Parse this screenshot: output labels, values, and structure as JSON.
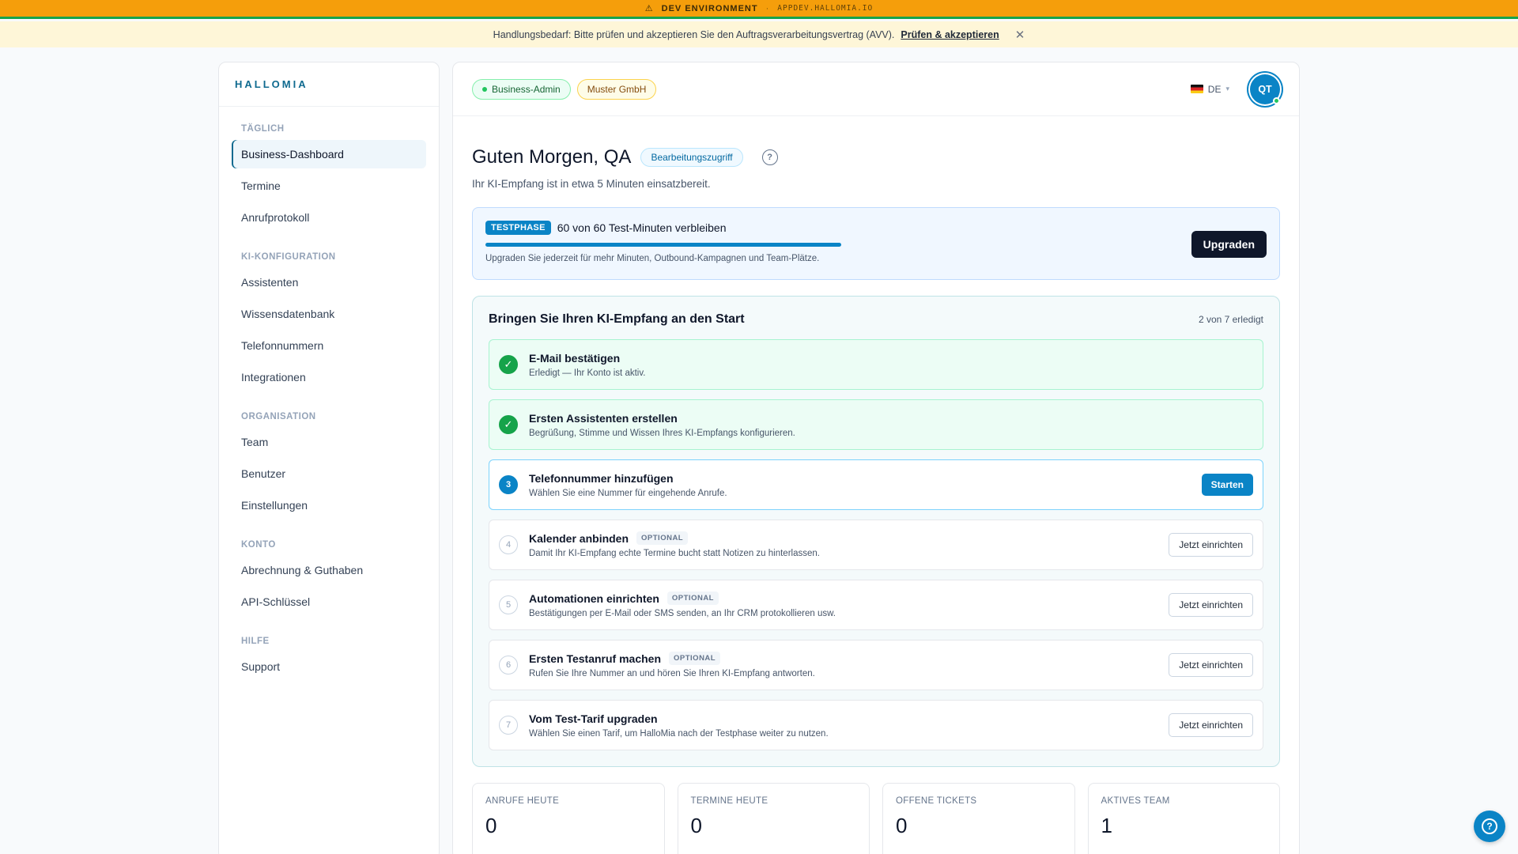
{
  "devbar": {
    "warning_icon": "⚠",
    "label": "DEV ENVIRONMENT",
    "separator": "·",
    "host": "APPDEV.HALLOMIA.IO"
  },
  "notice": {
    "text": "Handlungsbedarf: Bitte prüfen und akzeptieren Sie den Auftragsverarbeitungsvertrag (AVV).",
    "link": "Prüfen & akzeptieren",
    "close": "✕"
  },
  "sidebar": {
    "brand": "HALLOMIA",
    "sections": [
      {
        "title": "TÄGLICH",
        "items": [
          "Business-Dashboard",
          "Termine",
          "Anrufprotokoll"
        ]
      },
      {
        "title": "KI-KONFIGURATION",
        "items": [
          "Assistenten",
          "Wissensdatenbank",
          "Telefonnummern",
          "Integrationen"
        ]
      },
      {
        "title": "ORGANISATION",
        "items": [
          "Team",
          "Benutzer",
          "Einstellungen"
        ]
      },
      {
        "title": "KONTO",
        "items": [
          "Abrechnung & Guthaben",
          "API-Schlüssel"
        ]
      },
      {
        "title": "HILFE",
        "items": [
          "Support"
        ]
      }
    ]
  },
  "topbar": {
    "role": "Business-Admin",
    "org": "Muster GmbH",
    "lang": "DE",
    "avatar": "QT"
  },
  "greeting": {
    "title": "Guten Morgen, QA",
    "access": "Bearbeitungszugriff",
    "help": "?",
    "subtitle": "Ihr KI-Empfang ist in etwa 5 Minuten einsatzbereit."
  },
  "trial": {
    "tag": "TESTPHASE",
    "title": "60 von 60 Test-Minuten verbleiben",
    "progress": 1.0,
    "desc": "Upgraden Sie jederzeit für mehr Minuten, Outbound-Kampagnen und Team-Plätze.",
    "button": "Upgraden"
  },
  "onboarding": {
    "title": "Bringen Sie Ihren KI-Empfang an den Start",
    "count": "2 von 7 erledigt",
    "steps": [
      {
        "status": "done",
        "marker": "✓",
        "title": "E-Mail bestätigen",
        "desc": "Erledigt — Ihr Konto ist aktiv.",
        "optional": "",
        "action": ""
      },
      {
        "status": "done",
        "marker": "✓",
        "title": "Ersten Assistenten erstellen",
        "desc": "Begrüßung, Stimme und Wissen Ihres KI-Empfangs konfigurieren.",
        "optional": "",
        "action": ""
      },
      {
        "status": "current",
        "marker": "3",
        "title": "Telefonnummer hinzufügen",
        "desc": "Wählen Sie eine Nummer für eingehende Anrufe.",
        "optional": "",
        "action": "Starten"
      },
      {
        "status": "todo",
        "marker": "4",
        "title": "Kalender anbinden",
        "desc": "Damit Ihr KI-Empfang echte Termine bucht statt Notizen zu hinterlassen.",
        "optional": "OPTIONAL",
        "action": "Jetzt einrichten"
      },
      {
        "status": "todo",
        "marker": "5",
        "title": "Automationen einrichten",
        "desc": "Bestätigungen per E-Mail oder SMS senden, an Ihr CRM protokollieren usw.",
        "optional": "OPTIONAL",
        "action": "Jetzt einrichten"
      },
      {
        "status": "todo",
        "marker": "6",
        "title": "Ersten Testanruf machen",
        "desc": "Rufen Sie Ihre Nummer an und hören Sie Ihren KI-Empfang antworten.",
        "optional": "OPTIONAL",
        "action": "Jetzt einrichten"
      },
      {
        "status": "todo",
        "marker": "7",
        "title": "Vom Test-Tarif upgraden",
        "desc": "Wählen Sie einen Tarif, um HalloMia nach der Testphase weiter zu nutzen.",
        "optional": "",
        "action": "Jetzt einrichten"
      }
    ]
  },
  "stats": [
    {
      "label": "ANRUFE HEUTE",
      "value": "0"
    },
    {
      "label": "TERMINE HEUTE",
      "value": "0"
    },
    {
      "label": "OFFENE TICKETS",
      "value": "0"
    },
    {
      "label": "AKTIVES TEAM",
      "value": "1"
    }
  ],
  "fab": {
    "icon": "?"
  }
}
